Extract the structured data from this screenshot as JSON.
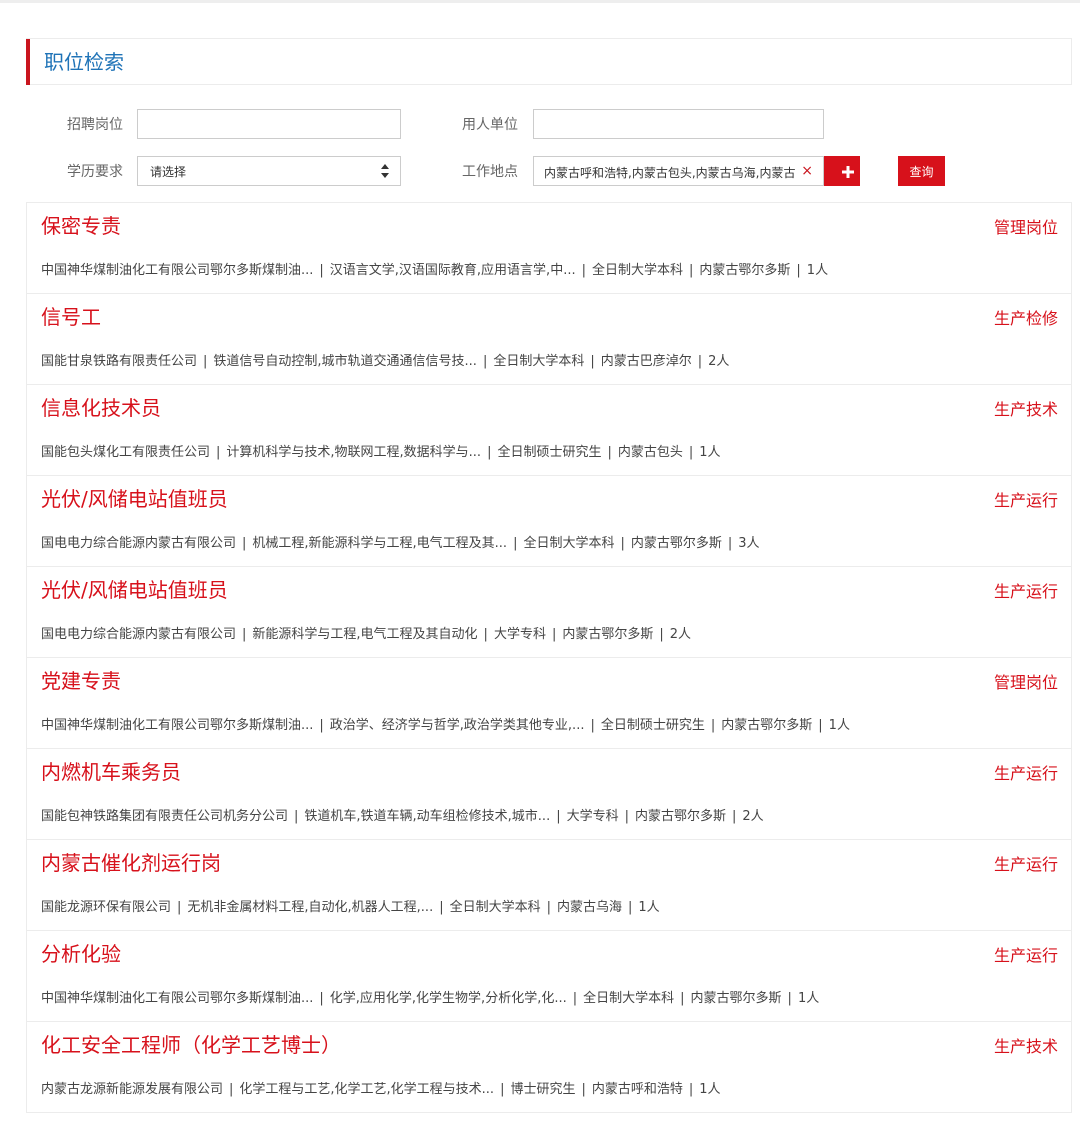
{
  "search": {
    "title": "职位检索",
    "position_label": "招聘岗位",
    "position_value": "",
    "employer_label": "用人单位",
    "employer_value": "",
    "education_label": "学历要求",
    "education_selected": "请选择",
    "location_label": "工作地点",
    "location_value": "内蒙古呼和浩特,内蒙古包头,内蒙古乌海,内蒙古鄂尔多斯",
    "clear_glyph": "×",
    "add_icon": "plus-icon",
    "query_label": "查询"
  },
  "jobs": [
    {
      "title": "保密专责",
      "category": "管理岗位",
      "company": "中国神华煤制油化工有限公司鄂尔多斯煤制油...",
      "major": "汉语言文学,汉语国际教育,应用语言学,中...",
      "education": "全日制大学本科",
      "location": "内蒙古鄂尔多斯",
      "count": "1人"
    },
    {
      "title": "信号工",
      "category": "生产检修",
      "company": "国能甘泉铁路有限责任公司",
      "major": "铁道信号自动控制,城市轨道交通通信信号技...",
      "education": "全日制大学本科",
      "location": "内蒙古巴彦淖尔",
      "count": "2人"
    },
    {
      "title": "信息化技术员",
      "category": "生产技术",
      "company": "国能包头煤化工有限责任公司",
      "major": "计算机科学与技术,物联网工程,数据科学与...",
      "education": "全日制硕士研究生",
      "location": "内蒙古包头",
      "count": "1人"
    },
    {
      "title": "光伏/风储电站值班员",
      "category": "生产运行",
      "company": "国电电力综合能源内蒙古有限公司",
      "major": "机械工程,新能源科学与工程,电气工程及其...",
      "education": "全日制大学本科",
      "location": "内蒙古鄂尔多斯",
      "count": "3人"
    },
    {
      "title": "光伏/风储电站值班员",
      "category": "生产运行",
      "company": "国电电力综合能源内蒙古有限公司",
      "major": "新能源科学与工程,电气工程及其自动化",
      "education": "大学专科",
      "location": "内蒙古鄂尔多斯",
      "count": "2人"
    },
    {
      "title": "党建专责",
      "category": "管理岗位",
      "company": "中国神华煤制油化工有限公司鄂尔多斯煤制油...",
      "major": "政治学、经济学与哲学,政治学类其他专业,...",
      "education": "全日制硕士研究生",
      "location": "内蒙古鄂尔多斯",
      "count": "1人"
    },
    {
      "title": "内燃机车乘务员",
      "category": "生产运行",
      "company": "国能包神铁路集团有限责任公司机务分公司",
      "major": "铁道机车,铁道车辆,动车组检修技术,城市...",
      "education": "大学专科",
      "location": "内蒙古鄂尔多斯",
      "count": "2人"
    },
    {
      "title": "内蒙古催化剂运行岗",
      "category": "生产运行",
      "company": "国能龙源环保有限公司",
      "major": "无机非金属材料工程,自动化,机器人工程,...",
      "education": "全日制大学本科",
      "location": "内蒙古乌海",
      "count": "1人"
    },
    {
      "title": "分析化验",
      "category": "生产运行",
      "company": "中国神华煤制油化工有限公司鄂尔多斯煤制油...",
      "major": "化学,应用化学,化学生物学,分析化学,化...",
      "education": "全日制大学本科",
      "location": "内蒙古鄂尔多斯",
      "count": "1人"
    },
    {
      "title": "化工安全工程师（化学工艺博士）",
      "category": "生产技术",
      "company": "内蒙古龙源新能源发展有限公司",
      "major": "化学工程与工艺,化学工艺,化学工程与技术...",
      "education": "博士研究生",
      "location": "内蒙古呼和浩特",
      "count": "1人"
    }
  ],
  "meta_separator": "|",
  "colors": {
    "accent": "#d7111b",
    "title_blue": "#1f73b7"
  }
}
